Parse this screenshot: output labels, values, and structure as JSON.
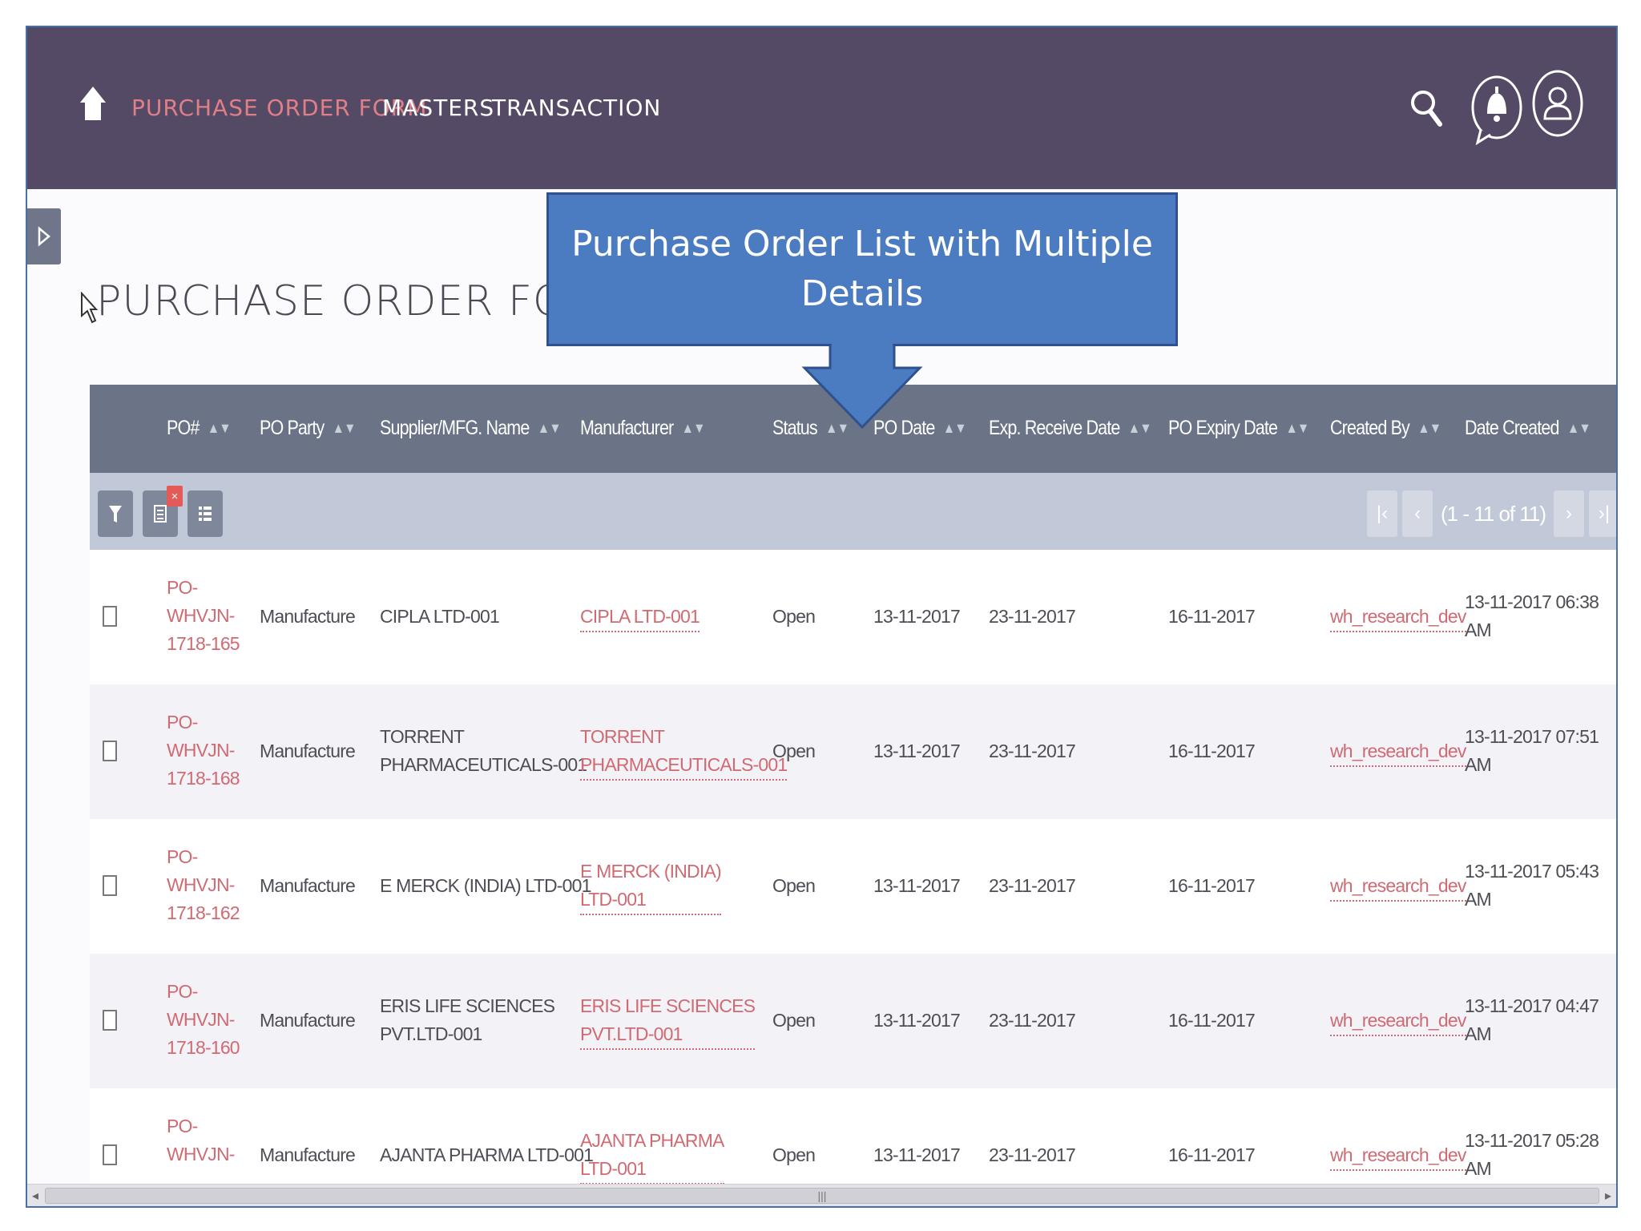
{
  "nav": {
    "items": [
      {
        "label": "PURCHASE ORDER FORM",
        "active": true
      },
      {
        "label": "MASTERS",
        "active": false
      },
      {
        "label": "TRANSACTION",
        "active": false
      }
    ],
    "icons": [
      "home-icon",
      "search-icon",
      "bell-icon",
      "user-icon"
    ]
  },
  "page": {
    "title": "PURCHASE ORDER FORM"
  },
  "callout": {
    "text": "Purchase Order List with Multiple Details"
  },
  "table": {
    "columns": [
      "PO#",
      "PO Party",
      "Supplier/MFG. Name",
      "Manufacturer",
      "Status",
      "PO Date",
      "Exp. Receive Date",
      "PO Expiry Date",
      "Created By",
      "Date Created"
    ],
    "pager": {
      "text": "(1 - 11 of 11)"
    },
    "rows": [
      {
        "po": "PO-\nWHVJN-\n1718-165",
        "party": "Manufacture",
        "supplier": "CIPLA LTD-001",
        "manufacturer": "CIPLA LTD-001",
        "status": "Open",
        "po_date": "13-11-2017",
        "exp_receive": "23-11-2017",
        "po_expiry": "16-11-2017",
        "created_by": "wh_research_dev",
        "date_created": "13-11-2017 06:38\nAM"
      },
      {
        "po": "PO-\nWHVJN-\n1718-168",
        "party": "Manufacture",
        "supplier": "TORRENT\nPHARMACEUTICALS-001",
        "manufacturer": "TORRENT\nPHARMACEUTICALS-001",
        "status": "Open",
        "po_date": "13-11-2017",
        "exp_receive": "23-11-2017",
        "po_expiry": "16-11-2017",
        "created_by": "wh_research_dev",
        "date_created": "13-11-2017 07:51\nAM"
      },
      {
        "po": "PO-\nWHVJN-\n1718-162",
        "party": "Manufacture",
        "supplier": "E MERCK (INDIA) LTD-001",
        "manufacturer": "E MERCK (INDIA)\nLTD-001",
        "status": "Open",
        "po_date": "13-11-2017",
        "exp_receive": "23-11-2017",
        "po_expiry": "16-11-2017",
        "created_by": "wh_research_dev",
        "date_created": "13-11-2017 05:43\nAM"
      },
      {
        "po": "PO-\nWHVJN-\n1718-160",
        "party": "Manufacture",
        "supplier": "ERIS LIFE SCIENCES\nPVT.LTD-001",
        "manufacturer": "ERIS LIFE SCIENCES\nPVT.LTD-001",
        "status": "Open",
        "po_date": "13-11-2017",
        "exp_receive": "23-11-2017",
        "po_expiry": "16-11-2017",
        "created_by": "wh_research_dev",
        "date_created": "13-11-2017 04:47\nAM"
      },
      {
        "po": "PO-\nWHVJN-",
        "party": "Manufacture",
        "supplier": "AJANTA PHARMA LTD-001",
        "manufacturer": "AJANTA PHARMA\nLTD-001",
        "status": "Open",
        "po_date": "13-11-2017",
        "exp_receive": "23-11-2017",
        "po_expiry": "16-11-2017",
        "created_by": "wh_research_dev",
        "date_created": "13-11-2017 05:28\nAM"
      }
    ]
  },
  "colors": {
    "topbar": "#544a66",
    "active_nav": "#e07f87",
    "header": "#6a7486",
    "toolbar": "#c1c8d7",
    "link": "#d06a73",
    "callout": "#4b7bc0"
  }
}
